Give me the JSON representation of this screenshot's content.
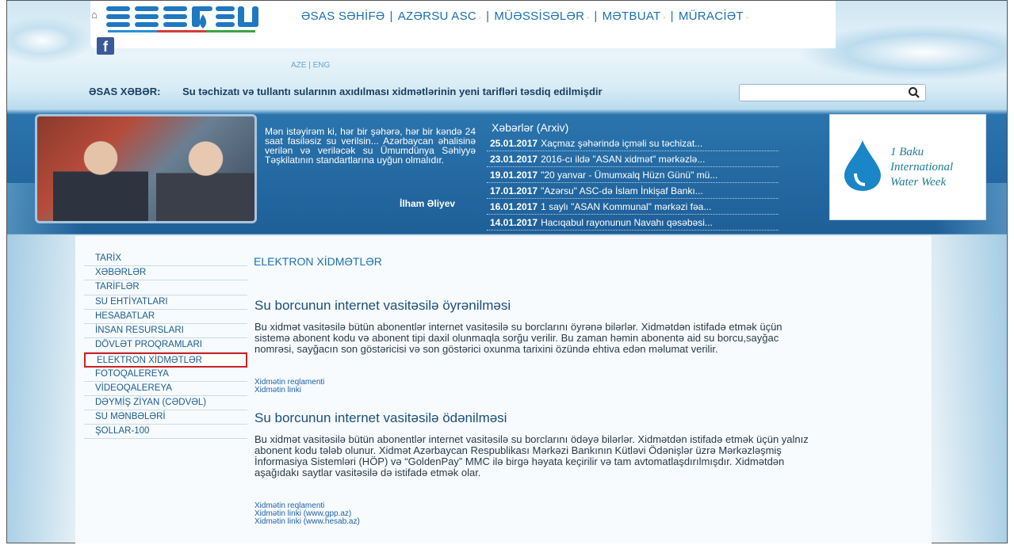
{
  "header": {
    "nav": [
      {
        "label": "ƏSAS SƏHİFƏ",
        "dropdown": false
      },
      {
        "label": "AZƏRSU ASC",
        "dropdown": true
      },
      {
        "label": "MÜƏSSİSƏLƏR",
        "dropdown": true
      },
      {
        "label": "MƏTBUAT",
        "dropdown": true
      },
      {
        "label": "MÜRACİƏT",
        "dropdown": true
      }
    ],
    "separator": "|",
    "lang": "AZE | ENG"
  },
  "ticker": {
    "label": "ƏSAS XƏBƏR:",
    "text": "Su təchizatı və tullantı sularının axıdılması xidmətlərinin yeni tarifləri təsdiq edilmişdir"
  },
  "search": {
    "placeholder": ""
  },
  "quote": {
    "text": "Mən istəyirəm ki, hər bir şəhərə, hər bir kəndə 24 saat fasiləsiz su verilsin... Azərbaycan əhalisinə verilən və veriləcək su Ümumdünya Səhiyyə Təşkilatının standartlarına uyğun olmalıdır.",
    "author": "İlham Əliyev"
  },
  "archive": {
    "title": "Xəbərlər (Arxiv)",
    "items": [
      {
        "date": "25.01.2017",
        "text": "Xaçmaz şəhərində içməli su təchizat..."
      },
      {
        "date": "23.01.2017",
        "text": "2016-cı ildə \"ASAN xidmət\" mərkəzlə..."
      },
      {
        "date": "19.01.2017",
        "text": "\"20 yanvar - Ümumxalq Hüzn Günü\" mü..."
      },
      {
        "date": "17.01.2017",
        "text": "\"Azərsu\" ASC-də İslam İnkişaf Bankı..."
      },
      {
        "date": "16.01.2017",
        "text": "1 saylı \"ASAN Kommunal\" mərkəzi fəa..."
      },
      {
        "date": "14.01.2017",
        "text": "Hacıqabul rayonunun Navahı qəsəbəsi..."
      }
    ]
  },
  "water_week": {
    "line1": "1 Baku",
    "line2": "International",
    "line3": "Water Week"
  },
  "sidebar": {
    "items": [
      "TARİX",
      "XƏBƏRLƏR",
      "TARİFLƏR",
      "SU EHTİYATLARI",
      "HESABATLAR",
      "İNSAN RESURSLARI",
      "DÖVLƏT PROQRAMLARI",
      "ELEKTRON XİDMƏTLƏR",
      "FOTOQALEREYA",
      "VİDEOQALEREYA",
      "DƏYMİŞ ZİYAN (CƏDVƏL)",
      "SU MƏNBƏLƏRİ",
      "ŞOLLAR-100"
    ],
    "active_index": 7
  },
  "main": {
    "title": "ELEKTRON XİDMƏTLƏR",
    "services": [
      {
        "title": "Su borcunun internet vasitəsilə öyrənilməsi",
        "desc": "Bu xidmət vasitəsilə bütün abonentlər internet vasitəsilə su borclarını öyrənə bilərlər. Xidmətdən istifadə etmək üçün sistemə abonent kodu və abonent tipi daxil olunmaqla sorğu verilir. Bu zaman həmin abonentə aid su borcu,sayğac nomrəsi, sayğacın son göstəricisi və son göstərici oxunma tarixini özündə ehtiva edən məlumat verilir.",
        "links": [
          "Xidmətin reqlamenti",
          "Xidmətin linki"
        ]
      },
      {
        "title": "Su borcunun internet vasitəsilə ödənilməsi",
        "desc": "Bu xidmət vasitəsilə bütün abonentlər internet vasitəsilə su borclarını ödəyə bilərlər. Xidmətdən istifadə etmək üçün yalnız abonent kodu tələb olunur. Xidmət Azərbaycan Respublikası Mərkəzi Bankının Kütləvi Ödənişlər üzrə Mərkəzləşmiş İnformasiya Sistemləri (HÖP) və “GoldenPay” MMC ilə birgə həyata keçirilir və tam avtomatlaşdırılmışdır. Xidmətdən aşağıdakı saytlar vasitəsilə də istifadə etmək olar.",
        "links": [
          "Xidmətin reqlamenti",
          "Xidmətin linki (www.gpp.az)",
          "Xidmətin linki (www.hesab.az)"
        ]
      }
    ]
  },
  "colors": {
    "brand_blue": "#1a6fb0",
    "active_border": "#cc2222",
    "band_blue": "#1f5f98"
  },
  "icons": [
    "home-icon",
    "azersu-logo",
    "facebook-icon",
    "search-icon",
    "water-drop-icon"
  ]
}
